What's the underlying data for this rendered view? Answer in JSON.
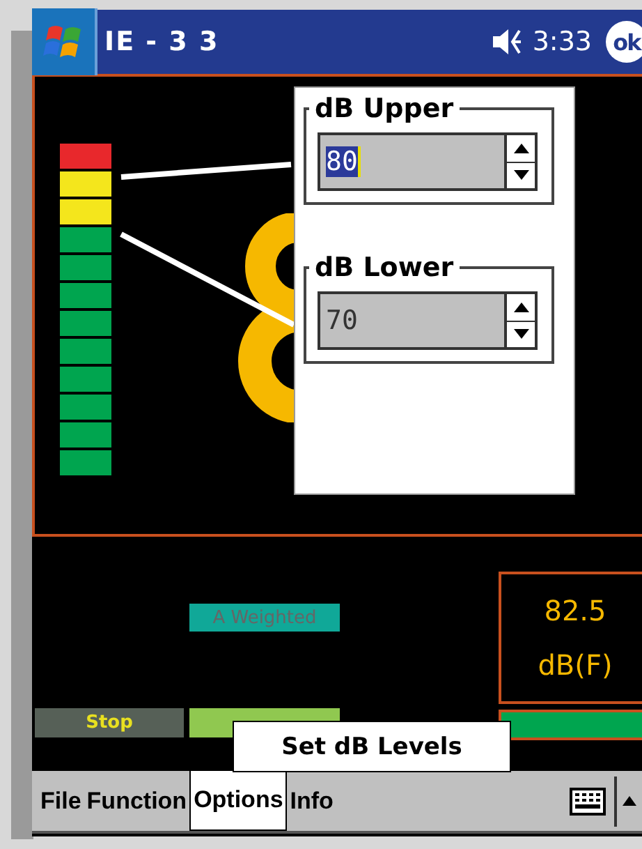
{
  "window": {
    "title": "IE - 3 3",
    "time": "3:33",
    "ok_label": "ok",
    "muted": true
  },
  "meter": {
    "segments": [
      {
        "color": "#e8282c"
      },
      {
        "color": "#f4e61c"
      },
      {
        "color": "#f4e61c"
      },
      {
        "color": "#00a54f"
      },
      {
        "color": "#00a54f"
      },
      {
        "color": "#00a54f"
      },
      {
        "color": "#00a54f"
      },
      {
        "color": "#00a54f"
      },
      {
        "color": "#00a54f"
      },
      {
        "color": "#00a54f"
      },
      {
        "color": "#00a54f"
      },
      {
        "color": "#00a54f"
      }
    ]
  },
  "dialog": {
    "fields": [
      {
        "label": "dB Upper",
        "value": "80",
        "selected": true
      },
      {
        "label": "dB Lower",
        "value": "70",
        "selected": false
      }
    ]
  },
  "weighting": "A Weighted",
  "reading": {
    "value": "82.5",
    "unit": "dB(F)"
  },
  "buttons": [
    {
      "label": "Stop"
    }
  ],
  "menu": {
    "items": [
      {
        "label": "File",
        "selected": false
      },
      {
        "label": "Function",
        "selected": false
      },
      {
        "label": "Options",
        "selected": true
      },
      {
        "label": "Info",
        "selected": false
      }
    ],
    "popup": [
      "Set dB Levels"
    ]
  }
}
